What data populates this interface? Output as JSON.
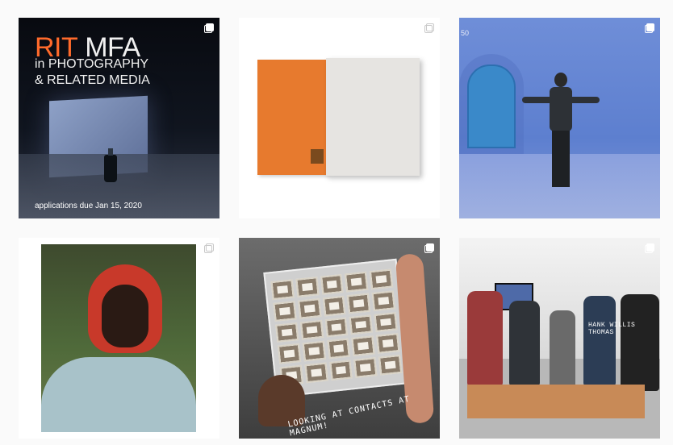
{
  "posts": [
    {
      "id": "post-1",
      "headline_primary": "RIT",
      "headline_rest": " MFA",
      "subhead": "in PHOTOGRAPHY\n& RELATED MEDIA",
      "caption": "applications due Jan 15, 2020",
      "multi": true
    },
    {
      "id": "post-2",
      "multi": true
    },
    {
      "id": "post-3",
      "label": "50",
      "multi": true
    },
    {
      "id": "post-4",
      "multi": true
    },
    {
      "id": "post-5",
      "caption": "LOOKING AT CONTACTS AT MAGNUM!",
      "multi": true
    },
    {
      "id": "post-6",
      "shirt_text": "HANK WILLIS THOMAS",
      "multi": true
    }
  ],
  "colors": {
    "page_bg": "#fafafa",
    "accent": "#ff6a2b"
  },
  "icons": {
    "multi": "multiple-posts-icon"
  }
}
